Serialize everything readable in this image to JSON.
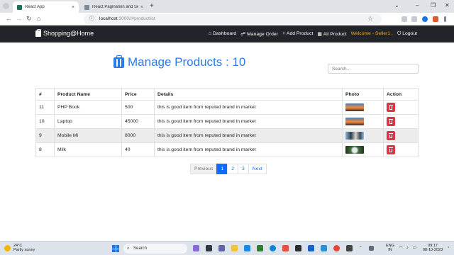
{
  "browser": {
    "tabs": [
      {
        "label": "React App",
        "close": "×"
      },
      {
        "label": "React Pagination and Search exam",
        "close": "×"
      }
    ],
    "new_tab": "+",
    "window_controls": [
      "⌄",
      "–",
      "❐",
      "✕"
    ],
    "url_host": "localhost",
    "url_path": ":3000/#/productlist"
  },
  "navbar": {
    "brand": "Shopping@Home",
    "links": [
      {
        "icon": "⌂",
        "label": "Dashboard"
      },
      {
        "icon": "☍",
        "label": "Manage Order"
      },
      {
        "icon": "+",
        "label": "Add Product"
      },
      {
        "icon": "▦",
        "label": "All Product"
      }
    ],
    "welcome": "Welcome - Seller1 ,",
    "logout_icon": "⏻",
    "logout": "Logout"
  },
  "page": {
    "title": "Manage Products : 10",
    "search_placeholder": "Search..."
  },
  "table": {
    "headers": [
      "#",
      "Product Name",
      "Price",
      "Details",
      "Photo",
      "Action"
    ],
    "rows": [
      {
        "id": "11",
        "name": "PHP Book",
        "price": "500",
        "details": "this is good item from reputed brand in market",
        "photo": "sunset-landscape"
      },
      {
        "id": "10",
        "name": "Laptop",
        "price": "45000",
        "details": "this is good item from reputed brand in market",
        "photo": "sunset-landscape"
      },
      {
        "id": "9",
        "name": "Mobile Mi",
        "price": "8000",
        "details": "this is good item from reputed brand in market",
        "photo": "people-group"
      },
      {
        "id": "8",
        "name": "Milk",
        "price": "40",
        "details": "this is good item from reputed brand in market",
        "photo": "flower-dark"
      }
    ]
  },
  "pagination": {
    "previous": "Previous",
    "pages": [
      "1",
      "2",
      "3"
    ],
    "active_page": "1",
    "next": "Next"
  },
  "taskbar": {
    "temperature": "24°C",
    "weather": "Partly sunny",
    "search": "Search",
    "lang_1": "ENG",
    "lang_2": "IN",
    "time": "09:17",
    "date": "08-10-2023"
  },
  "colors": {
    "accent": "#2c7be5",
    "navbar_bg": "#212529",
    "welcome": "#f5a623",
    "danger": "#dc3545",
    "page_active": "#0d6efd"
  }
}
